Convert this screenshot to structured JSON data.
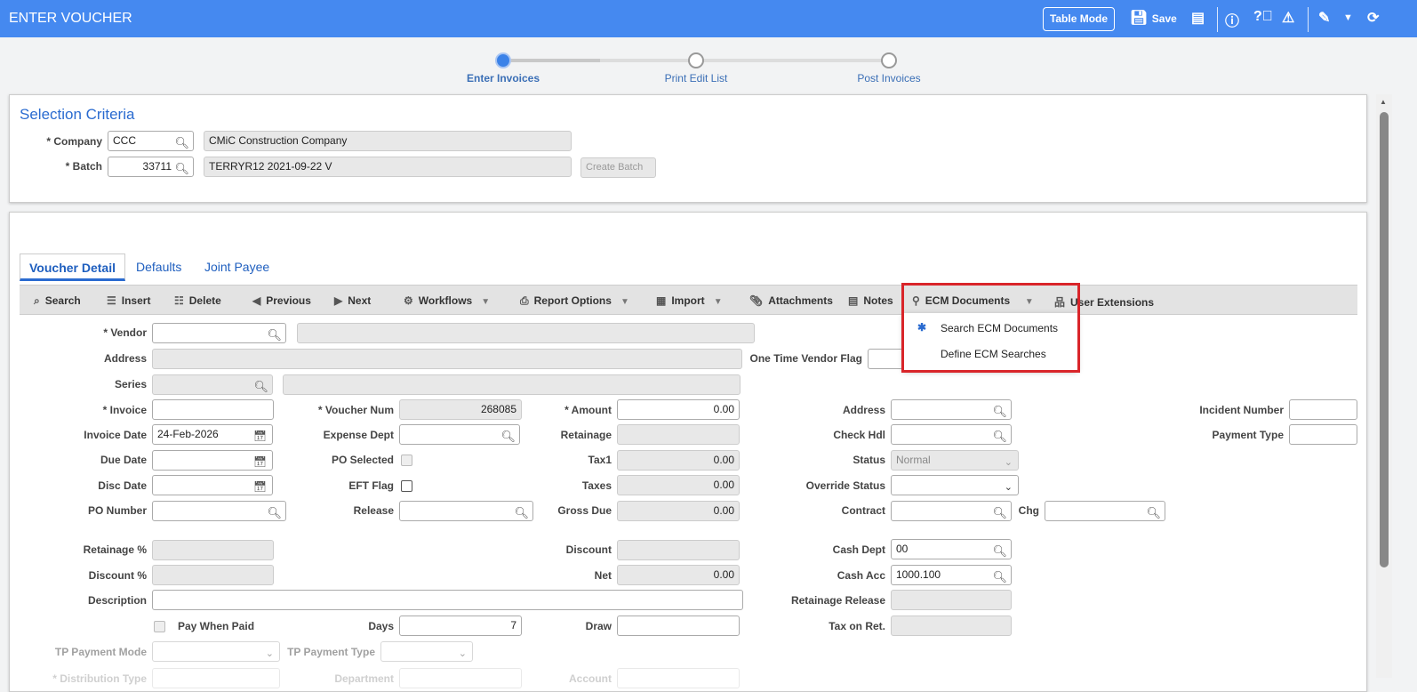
{
  "header": {
    "title": "ENTER VOUCHER",
    "table_mode": "Table Mode",
    "save": "Save",
    "color": "#4589f0"
  },
  "stepper": [
    "Enter Invoices",
    "Print Edit List",
    "Post Invoices"
  ],
  "selection": {
    "title": "Selection Criteria",
    "company_label": "* Company",
    "company": "CCC",
    "company_name": "CMiC Construction Company",
    "batch_label": "* Batch",
    "batch": "33711",
    "batch_name": "TERRYR12 2021-09-22 V",
    "create_batch": "Create Batch"
  },
  "tabs": [
    "Voucher Detail",
    "Defaults",
    "Joint Payee"
  ],
  "toolbar": [
    "Search",
    "Insert",
    "Delete",
    "Previous",
    "Next",
    "Workflows",
    "Report Options",
    "Import",
    "Attachments",
    "Notes",
    "ECM Documents",
    "User Extensions"
  ],
  "ecm_menu": [
    "Search ECM Documents",
    "Define ECM Searches"
  ],
  "labels": {
    "vendor": "* Vendor",
    "address": "Address",
    "otvf": "One Time Vendor Flag",
    "series": "Series",
    "invoice": "* Invoice",
    "voucher_num": "* Voucher Num",
    "amount": "* Amount",
    "address2": "Address",
    "incident": "Incident Number",
    "invoice_date": "Invoice Date",
    "expense_dept": "Expense Dept",
    "retainage": "Retainage",
    "check_hdl": "Check Hdl",
    "payment_type": "Payment Type",
    "due_date": "Due Date",
    "po_selected": "PO Selected",
    "tax1": "Tax1",
    "status": "Status",
    "disc_date": "Disc Date",
    "eft_flag": "EFT Flag",
    "taxes": "Taxes",
    "override_status": "Override Status",
    "po_number": "PO Number",
    "release": "Release",
    "gross_due": "Gross Due",
    "contract": "Contract",
    "chg": "Chg",
    "retainage_pct": "Retainage %",
    "discount": "Discount",
    "cash_dept": "Cash Dept",
    "discount_pct": "Discount %",
    "net": "Net",
    "cash_acc": "Cash Acc",
    "description": "Description",
    "retainage_release": "Retainage Release",
    "pay_when_paid": "Pay When Paid",
    "days": "Days",
    "draw": "Draw",
    "tax_on_ret": "Tax on Ret.",
    "tp_mode": "TP Payment Mode",
    "tp_type": "TP Payment Type",
    "dist_type": "* Distribution Type",
    "department": "Department",
    "account": "Account"
  },
  "values": {
    "voucher_num": "268085",
    "amount": "0.00",
    "invoice_date": "24-Feb-2026",
    "tax1": "0.00",
    "status": "Normal",
    "taxes": "0.00",
    "gross_due": "0.00",
    "cash_dept": "00",
    "net": "0.00",
    "cash_acc": "1000.100",
    "days": "7"
  }
}
